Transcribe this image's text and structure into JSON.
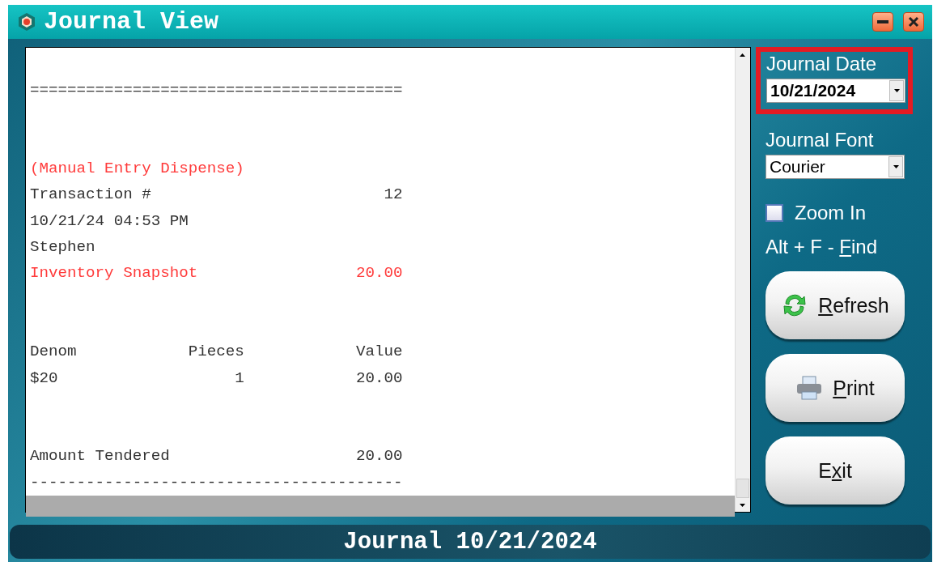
{
  "window": {
    "title": "Journal View"
  },
  "journal": {
    "lines": [
      {
        "kind": "blank"
      },
      {
        "kind": "text",
        "text": "========================================",
        "color": "#333333"
      },
      {
        "kind": "blank"
      },
      {
        "kind": "blank"
      },
      {
        "kind": "text",
        "text": "(Manual Entry Dispense)",
        "color": "#ff3b3b"
      },
      {
        "kind": "text",
        "text": "Transaction #                         12",
        "color": "#333333"
      },
      {
        "kind": "text",
        "text": "10/21/24 04:53 PM",
        "color": "#333333"
      },
      {
        "kind": "text",
        "text": "Stephen",
        "color": "#333333"
      },
      {
        "kind": "text",
        "text": "Inventory Snapshot                 20.00",
        "color": "#ff3b3b"
      },
      {
        "kind": "blank"
      },
      {
        "kind": "blank"
      },
      {
        "kind": "text",
        "text": "Denom            Pieces            Value",
        "color": "#333333"
      },
      {
        "kind": "text",
        "text": "$20                   1            20.00",
        "color": "#333333"
      },
      {
        "kind": "blank"
      },
      {
        "kind": "blank"
      },
      {
        "kind": "text",
        "text": "Amount Tendered                    20.00",
        "color": "#333333"
      },
      {
        "kind": "text",
        "text": "----------------------------------------",
        "color": "#333333"
      }
    ]
  },
  "side": {
    "date_label": "Journal Date",
    "date_value": "10/21/2024",
    "date_highlighted": true,
    "font_label": "Journal Font",
    "font_value": "Courier",
    "zoom": {
      "label": "Zoom In",
      "checked": false
    },
    "hint": {
      "text_before": "Alt + F - ",
      "access_key": "F",
      "text_after": "ind"
    },
    "buttons": [
      {
        "kind": "refresh",
        "access_key": "R",
        "text_after": "efresh"
      },
      {
        "kind": "print",
        "access_key": "P",
        "text_after": "rint"
      },
      {
        "kind": "plain",
        "text_before": "E",
        "access_key": "x",
        "text_after": "it"
      }
    ]
  },
  "status_bar": {
    "text": "Journal 10/21/2024"
  }
}
